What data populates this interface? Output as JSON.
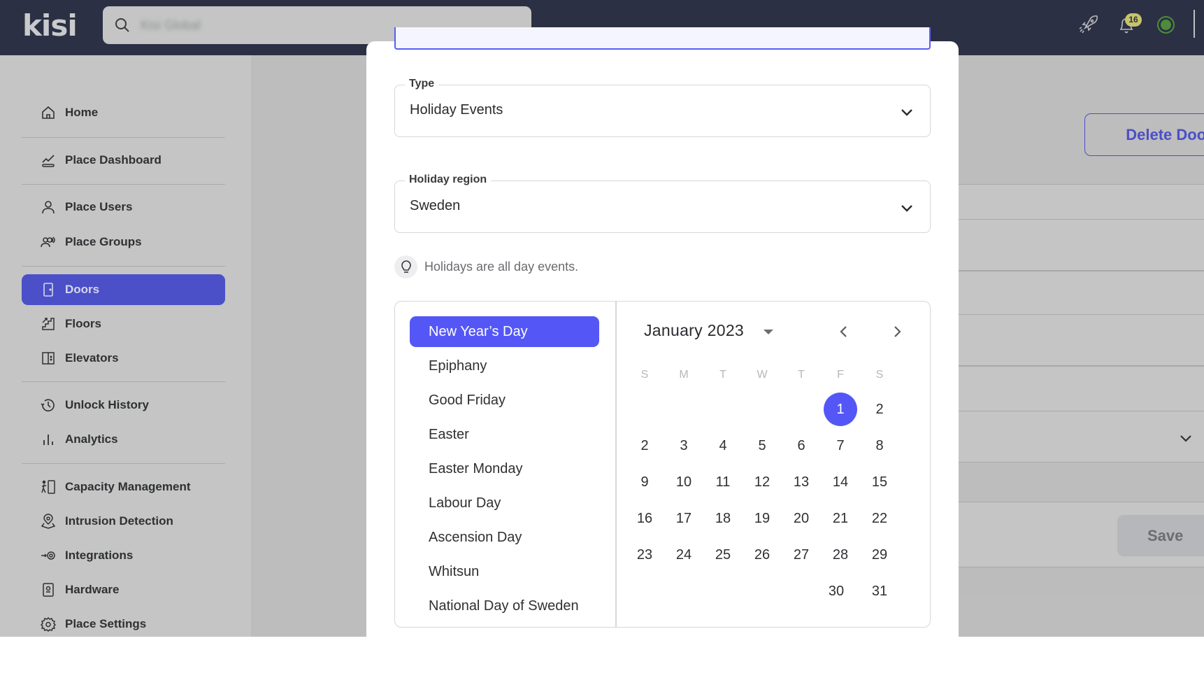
{
  "header": {
    "logo": "kisi",
    "search_placeholder": "Kisi Global",
    "notification_count": "16",
    "colors": {
      "bg": "#2b3044",
      "status": "#4c8c3a",
      "badge": "#c8c36a"
    }
  },
  "sidebar": {
    "items": [
      {
        "label": "Home",
        "icon": "home-icon"
      },
      {
        "label": "Place Dashboard",
        "icon": "chart-line-icon"
      },
      {
        "label": "Place Users",
        "icon": "user-icon"
      },
      {
        "label": "Place Groups",
        "icon": "users-icon"
      },
      {
        "label": "Doors",
        "icon": "door-icon",
        "active": true
      },
      {
        "label": "Floors",
        "icon": "stairs-icon"
      },
      {
        "label": "Elevators",
        "icon": "elevator-icon"
      },
      {
        "label": "Unlock History",
        "icon": "history-icon"
      },
      {
        "label": "Analytics",
        "icon": "bar-chart-icon"
      },
      {
        "label": "Capacity Management",
        "icon": "capacity-icon"
      },
      {
        "label": "Intrusion Detection",
        "icon": "map-pin-icon"
      },
      {
        "label": "Integrations",
        "icon": "integration-gear-icon"
      },
      {
        "label": "Hardware",
        "icon": "hardware-icon"
      },
      {
        "label": "Place Settings",
        "icon": "settings-icon"
      }
    ],
    "accent": "#4b4fc8"
  },
  "background": {
    "delete_door_label": "Delete Door",
    "save_label": "Save"
  },
  "modal": {
    "type_field": {
      "label": "Type",
      "value": "Holiday Events"
    },
    "region_field": {
      "label": "Holiday region",
      "value": "Sweden"
    },
    "hint": "Holidays are all day events.",
    "holidays": [
      "New Year’s Day",
      "Epiphany",
      "Good Friday",
      "Easter",
      "Easter Monday",
      "Labour Day",
      "Ascension Day",
      "Whitsun",
      "National Day of Sweden"
    ],
    "selected_holiday": "New Year’s Day",
    "calendar": {
      "month": "January",
      "year": "2023",
      "weekdays": [
        "S",
        "M",
        "T",
        "W",
        "T",
        "F",
        "S"
      ],
      "weeks": [
        [
          "",
          "",
          "",
          "",
          "",
          "1",
          "2"
        ],
        [
          "2",
          "3",
          "4",
          "5",
          "6",
          "7",
          "8"
        ],
        [
          "9",
          "10",
          "11",
          "12",
          "13",
          "14",
          "15"
        ],
        [
          "16",
          "17",
          "18",
          "19",
          "20",
          "21",
          "22"
        ],
        [
          "23",
          "24",
          "25",
          "26",
          "27",
          "28",
          "29"
        ],
        [
          "",
          "",
          "",
          "",
          "",
          "30",
          "31"
        ]
      ],
      "selected_day": "1",
      "accent": "#5457f6"
    }
  }
}
